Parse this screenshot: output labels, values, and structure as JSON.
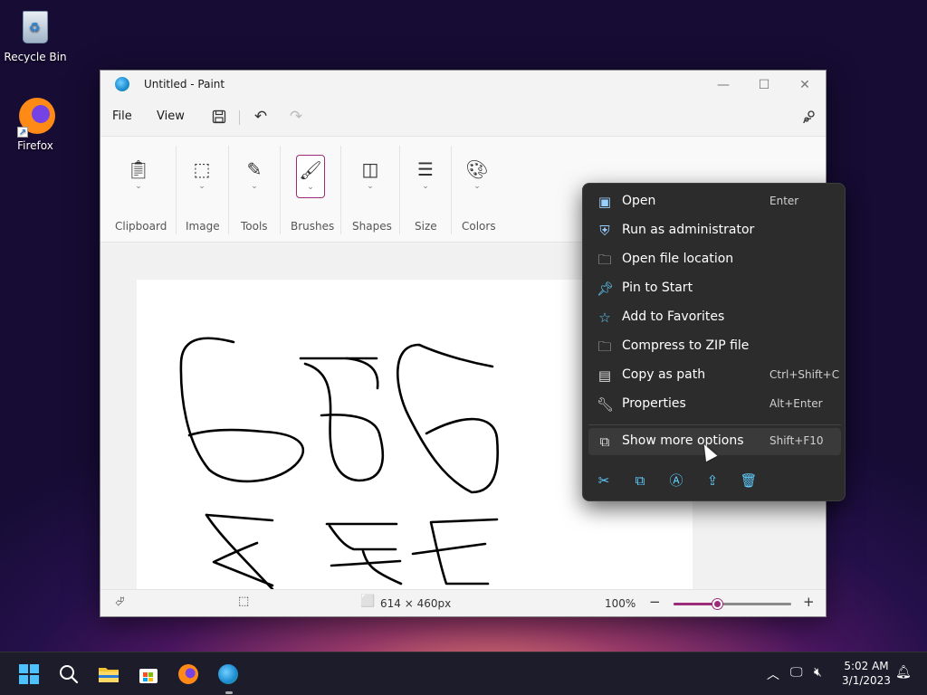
{
  "desktop": {
    "icons": [
      {
        "label": "Recycle Bin"
      },
      {
        "label": "Firefox"
      }
    ]
  },
  "window": {
    "title": "Untitled - Paint",
    "controls": {
      "minimize": "—",
      "maximize": "☐",
      "close": "✕"
    }
  },
  "menubar": {
    "file": "File",
    "view": "View",
    "icons": [
      "save-icon",
      "undo-icon",
      "redo-icon",
      "settings-icon"
    ]
  },
  "ribbon": {
    "groups": [
      {
        "label": "Clipboard",
        "icon": "clipboard-icon"
      },
      {
        "label": "Image",
        "icon": "selection-icon"
      },
      {
        "label": "Tools",
        "icon": "tools-icon"
      },
      {
        "label": "Brushes",
        "icon": "brush-icon",
        "active": true
      },
      {
        "label": "Shapes",
        "icon": "shapes-icon"
      },
      {
        "label": "Size",
        "icon": "size-icon"
      },
      {
        "label": "Colors",
        "icon": "palette-icon"
      }
    ]
  },
  "statusbar": {
    "canvas_size": "614 × 460px",
    "zoom": "100%",
    "zoom_level_fraction": 0.38
  },
  "context_menu": {
    "items": [
      {
        "label": "Open",
        "shortcut": "Enter",
        "icon": "open-icon"
      },
      {
        "label": "Run as administrator",
        "shortcut": "",
        "icon": "shield-icon"
      },
      {
        "label": "Open file location",
        "shortcut": "",
        "icon": "folder-icon"
      },
      {
        "label": "Pin to Start",
        "shortcut": "",
        "icon": "pin-icon"
      },
      {
        "label": "Add to Favorites",
        "shortcut": "",
        "icon": "star-icon"
      },
      {
        "label": "Compress to ZIP file",
        "shortcut": "",
        "icon": "zip-icon"
      },
      {
        "label": "Copy as path",
        "shortcut": "Ctrl+Shift+C",
        "icon": "copy-path-icon"
      },
      {
        "label": "Properties",
        "shortcut": "Alt+Enter",
        "icon": "wrench-icon"
      }
    ],
    "more_options": {
      "label": "Show more options",
      "shortcut": "Shift+F10",
      "icon": "more-options-icon"
    },
    "actions": [
      "cut-icon",
      "copy-icon",
      "rename-icon",
      "share-icon",
      "delete-icon"
    ]
  },
  "taskbar": {
    "time": "5:02 AM",
    "date": "3/1/2023"
  }
}
